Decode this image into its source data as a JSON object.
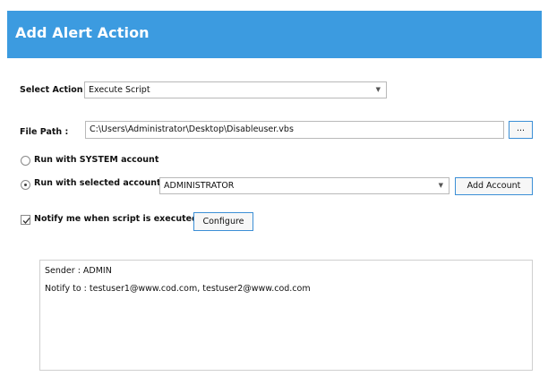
{
  "dialog": {
    "title": "Add Alert Action"
  },
  "select_action": {
    "label": "Select Action :",
    "value": "Execute Script"
  },
  "file_path": {
    "label": "File Path :",
    "value": "C:\\Users\\Administrator\\Desktop\\Disableuser.vbs",
    "browse_label": "..."
  },
  "run_as": {
    "system_label": "Run with SYSTEM account",
    "selected_label": "Run with selected account",
    "selected_checked": true,
    "account_value": "ADMINISTRATOR",
    "add_account_label": "Add Account"
  },
  "notify": {
    "label": "Notify me when script is executed",
    "checked": true,
    "configure_label": "Configure"
  },
  "message": {
    "sender": "Sender : ADMIN",
    "notify_to": "Notify to : testuser1@www.cod.com, testuser2@www.cod.com"
  },
  "colors": {
    "title_bar": "#3c9be0",
    "button_border": "#3c8fd6"
  }
}
